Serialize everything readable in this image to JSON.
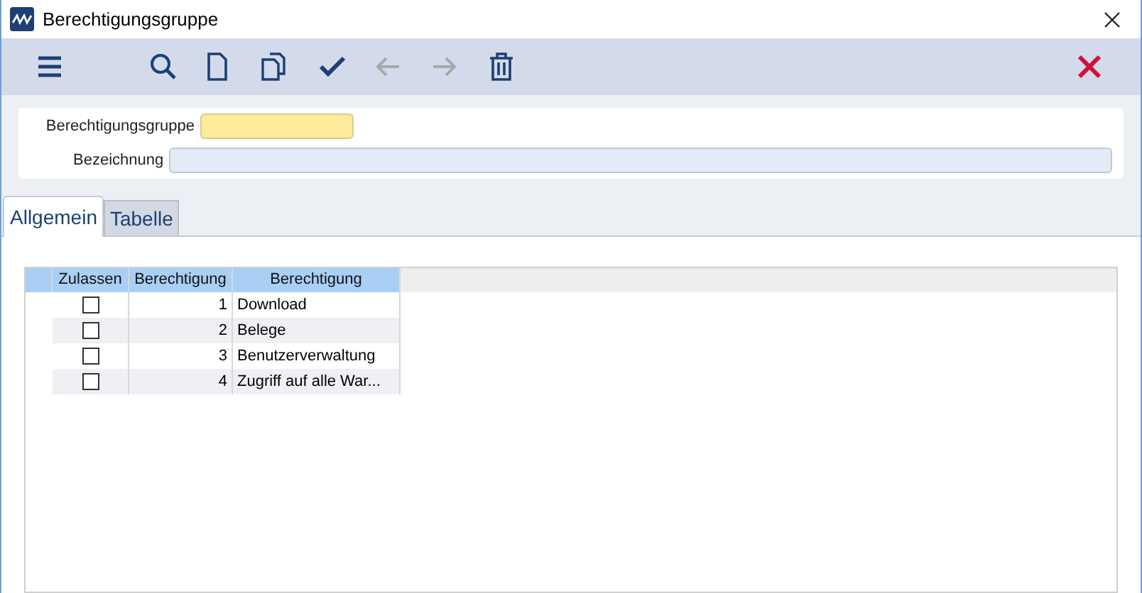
{
  "window": {
    "title": "Berechtigungsgruppe"
  },
  "toolbar": [
    {
      "kind": "menu",
      "disabled": false
    },
    {
      "kind": "search",
      "disabled": false
    },
    {
      "kind": "new",
      "disabled": false
    },
    {
      "kind": "copy",
      "disabled": false
    },
    {
      "kind": "save",
      "disabled": false
    },
    {
      "kind": "back",
      "disabled": true
    },
    {
      "kind": "forward",
      "disabled": true
    },
    {
      "kind": "delete",
      "disabled": false
    }
  ],
  "form": {
    "fields": [
      {
        "label": "Berechtigungsgruppe",
        "kind": "required"
      },
      {
        "label": "Bezeichnung",
        "kind": "normal"
      }
    ]
  },
  "tabs": [
    {
      "label": "Allgemein",
      "selected": true
    },
    {
      "label": "Tabelle",
      "selected": false
    }
  ],
  "table": {
    "columns": [
      "Zulassen",
      "Berechtigung",
      "Berechtigung"
    ],
    "rows": [
      {
        "checked": false,
        "number": "1",
        "name": "Download"
      },
      {
        "checked": false,
        "number": "2",
        "name": "Belege"
      },
      {
        "checked": false,
        "number": "3",
        "name": "Benutzerverwaltung"
      },
      {
        "checked": false,
        "number": "4",
        "name": "Zugriff auf alle War..."
      }
    ]
  }
}
